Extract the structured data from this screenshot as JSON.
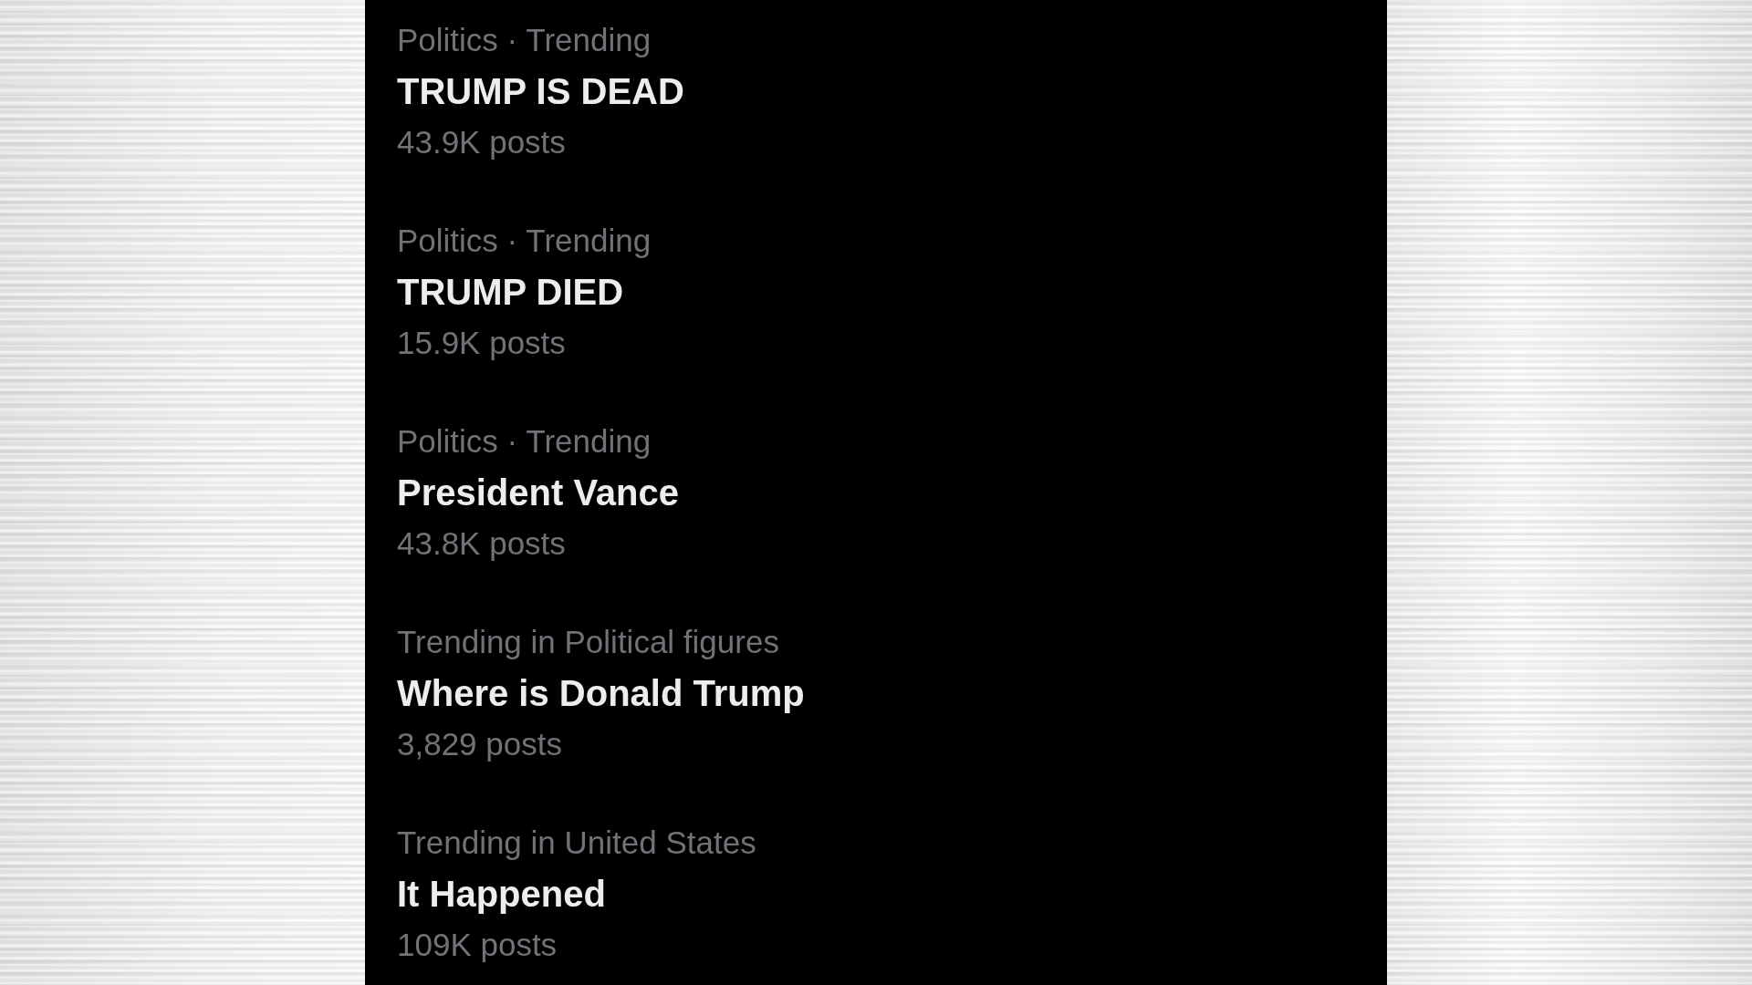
{
  "trends": [
    {
      "context": "Politics · Trending",
      "title": "TRUMP IS DEAD",
      "post_count": "43.9K posts"
    },
    {
      "context": "Politics · Trending",
      "title": "TRUMP DIED",
      "post_count": "15.9K posts"
    },
    {
      "context": "Politics · Trending",
      "title": "President Vance",
      "post_count": "43.8K posts"
    },
    {
      "context": "Trending in Political figures",
      "title": "Where is Donald Trump",
      "post_count": "3,829 posts"
    },
    {
      "context": "Trending in United States",
      "title": "It Happened",
      "post_count": "109K posts"
    }
  ]
}
